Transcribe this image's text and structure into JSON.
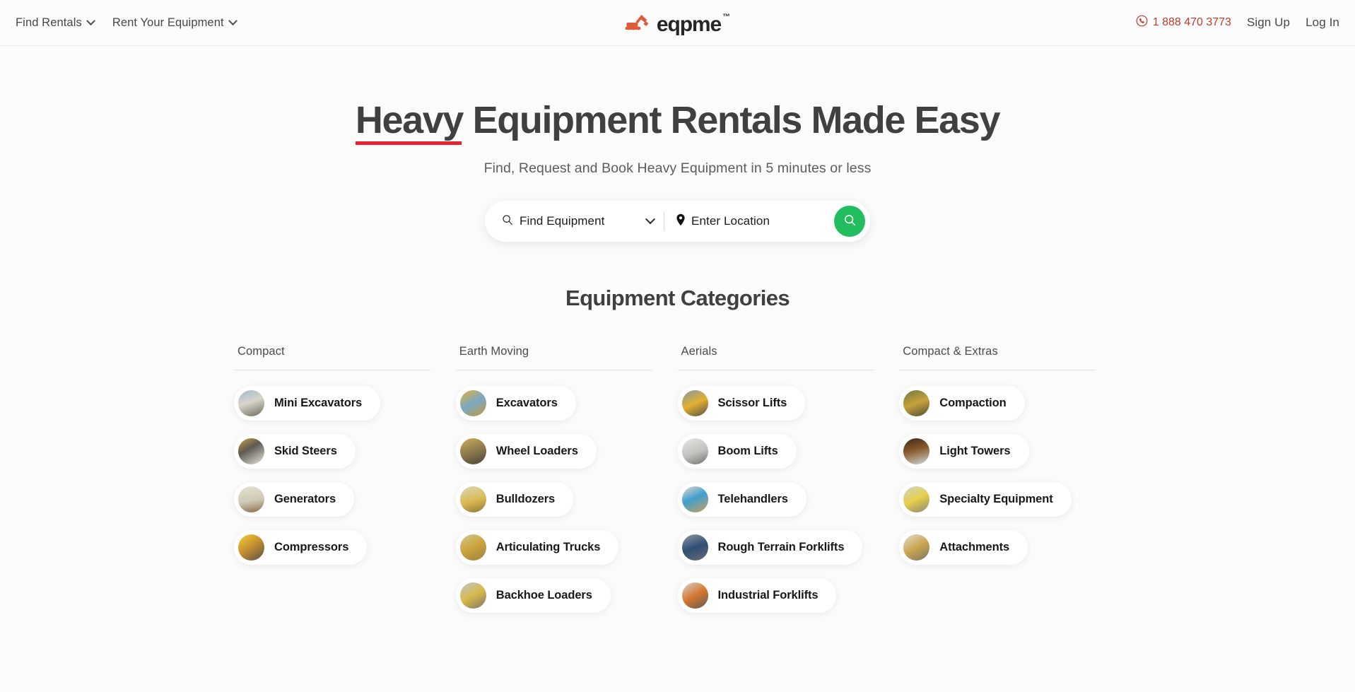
{
  "header": {
    "nav_left": [
      {
        "label": "Find Rentals",
        "has_chevron": true
      },
      {
        "label": "Rent Your Equipment",
        "has_chevron": true
      }
    ],
    "logo": {
      "text": "eqpme",
      "tm": "™",
      "icon": "excavator-icon",
      "accent": "#e05a3c"
    },
    "phone": {
      "number": "1 888 470 3773",
      "icon": "phone-circle-icon",
      "color": "#c0392b"
    },
    "sign_up": "Sign Up",
    "log_in": "Log In"
  },
  "hero": {
    "title_highlight": "Heavy",
    "title_rest": " Equipment Rentals Made Easy",
    "underline_color": "#e8212e",
    "subtitle": "Find, Request and Book Heavy Equipment in 5 minutes or less"
  },
  "search": {
    "equipment_placeholder": "Find Equipment",
    "equipment_icon": "search-icon",
    "dropdown_icon": "chevron-down-icon",
    "location_placeholder": "Enter Location",
    "location_icon": "map-pin-icon",
    "button_icon": "search-icon",
    "button_color": "#22bd5f"
  },
  "categories": {
    "title": "Equipment Categories",
    "columns": [
      {
        "heading": "Compact",
        "items": [
          {
            "label": "Mini Excavators",
            "thumb": "t-mini"
          },
          {
            "label": "Skid Steers",
            "thumb": "t-skid"
          },
          {
            "label": "Generators",
            "thumb": "t-gen"
          },
          {
            "label": "Compressors",
            "thumb": "t-comp"
          }
        ]
      },
      {
        "heading": "Earth Moving",
        "items": [
          {
            "label": "Excavators",
            "thumb": "t-exc"
          },
          {
            "label": "Wheel Loaders",
            "thumb": "t-wheel"
          },
          {
            "label": "Bulldozers",
            "thumb": "t-bull"
          },
          {
            "label": "Articulating Trucks",
            "thumb": "t-artic"
          },
          {
            "label": "Backhoe Loaders",
            "thumb": "t-backh"
          }
        ]
      },
      {
        "heading": "Aerials",
        "items": [
          {
            "label": "Scissor Lifts",
            "thumb": "t-scis"
          },
          {
            "label": "Boom Lifts",
            "thumb": "t-boom"
          },
          {
            "label": "Telehandlers",
            "thumb": "t-tele"
          },
          {
            "label": "Rough Terrain Forklifts",
            "thumb": "t-rough"
          },
          {
            "label": "Industrial Forklifts",
            "thumb": "t-indus"
          }
        ]
      },
      {
        "heading": "Compact & Extras",
        "items": [
          {
            "label": "Compaction",
            "thumb": "t-compa"
          },
          {
            "label": "Light Towers",
            "thumb": "t-light"
          },
          {
            "label": "Specialty Equipment",
            "thumb": "t-spec"
          },
          {
            "label": "Attachments",
            "thumb": "t-attach"
          }
        ]
      }
    ]
  }
}
